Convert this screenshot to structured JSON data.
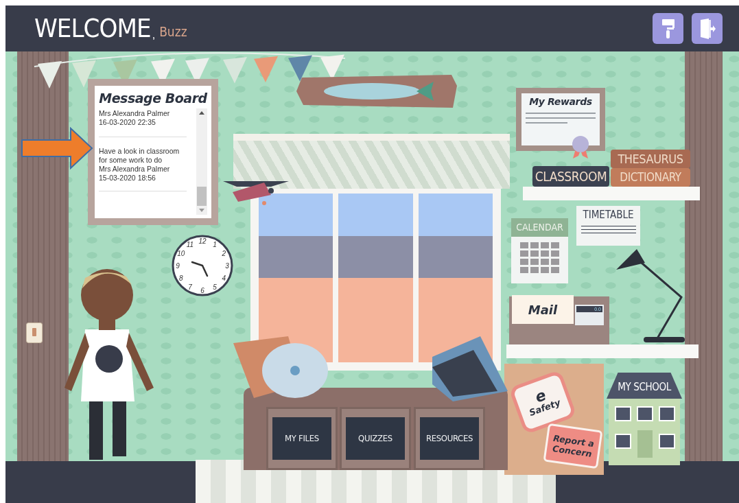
{
  "header": {
    "title": "WELCOME",
    "separator": ",",
    "user_name": "Buzz",
    "buttons": [
      {
        "kind": "paint"
      },
      {
        "kind": "logout"
      }
    ]
  },
  "message_board": {
    "title": "Message Board",
    "messages": [
      {
        "author": "Mrs Alexandra Palmer",
        "date": "16-03-2020 22:35"
      },
      {
        "text": "Have a look in classroom for some work to do",
        "author": "Mrs Alexandra Palmer",
        "date": "15-03-2020 18:56"
      }
    ]
  },
  "clock": {
    "numbers": [
      "12",
      "1",
      "2",
      "3",
      "4",
      "5",
      "6",
      "7",
      "8",
      "9",
      "10",
      "11"
    ]
  },
  "rewards": {
    "title": "My Rewards"
  },
  "books": [
    {
      "label": "CLASSROOM",
      "color": "#3b4150"
    },
    {
      "label": "THESAURUS",
      "color": "#a86a52"
    },
    {
      "label": "DICTIONARY",
      "color": "#c17c5b"
    }
  ],
  "timetable": {
    "title": "TIMETABLE"
  },
  "calendar": {
    "title": "CALENDAR"
  },
  "mail": {
    "title": "Mail",
    "calculator_display": "0.0"
  },
  "esafety": {
    "mark": "e",
    "label": "Safety"
  },
  "report": {
    "label": "Report a Concern"
  },
  "school": {
    "label": "MY SCHOOL"
  },
  "drawers": [
    {
      "label": "MY FILES"
    },
    {
      "label": "QUIZZES"
    },
    {
      "label": "RESOURCES"
    }
  ]
}
